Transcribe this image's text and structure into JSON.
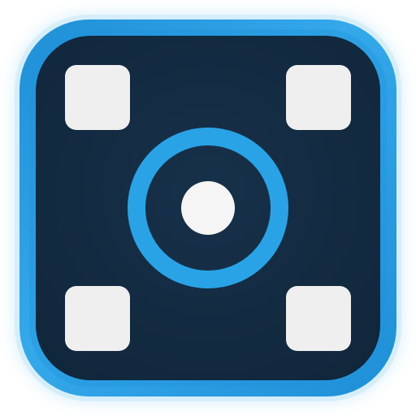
{
  "app_icon": {
    "icon": "app-icon",
    "colors": {
      "frame_outer": "#2a9fe0",
      "frame_inner": "#55b8ee",
      "glow": "#a9dcf8",
      "tile_background": "#132a40",
      "corner_dots": "#efefef",
      "ring": "#29a3e6",
      "center_dot": "#f5f5f5"
    },
    "parts": [
      "outer-frame",
      "dark-tile",
      "corner-dots",
      "focus-ring",
      "center-dot"
    ]
  }
}
